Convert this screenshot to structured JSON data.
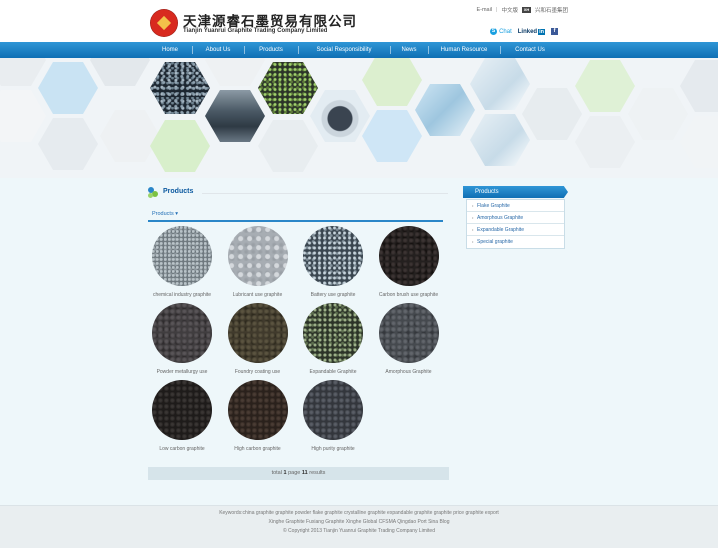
{
  "header": {
    "logo_cn": "天津源睿石墨贸易有限公司",
    "logo_en": "Tianjin Yuanrui Graphite Trading Company Limited",
    "top_links": [
      "E-mail",
      "中文版",
      "兴和石墨集团"
    ],
    "top_link_logo": "XH",
    "skype_label": "Chat",
    "linkedin_label": "Linked",
    "linkedin_badge": "in",
    "facebook_label": "f"
  },
  "nav": {
    "items": [
      "Home",
      "About Us",
      "Products",
      "Social Responsibility",
      "News",
      "Human Resource",
      "Contact Us"
    ]
  },
  "products": {
    "title": "Products",
    "tab_label": "Products ▾",
    "items": [
      {
        "caption": "chemical industry graphite",
        "texture": "gray"
      },
      {
        "caption": "Lubricant use graphite",
        "texture": "silver"
      },
      {
        "caption": "Battery use graphite",
        "texture": "flake"
      },
      {
        "caption": "Carbon brush use graphite",
        "texture": "black"
      },
      {
        "caption": "Powder metallurgy use",
        "texture": "charcoal"
      },
      {
        "caption": "Foundry coating use",
        "texture": "brown"
      },
      {
        "caption": "Expandable Graphite",
        "texture": "green"
      },
      {
        "caption": "Amorphous Graphite",
        "texture": "amorph"
      },
      {
        "caption": "Low carbon graphite",
        "texture": "deep"
      },
      {
        "caption": "High carbon graphite",
        "texture": "deepbrown"
      },
      {
        "caption": "High purity graphite",
        "texture": "slate"
      }
    ],
    "pager": {
      "prefix": "total",
      "pages": "1",
      "mid": "page",
      "results": "11",
      "suffix": "results"
    }
  },
  "sidebar": {
    "title": "Products",
    "items": [
      "Flake Graphite",
      "Amorphous Graphite",
      "Expandable Graphite",
      "Special graphite"
    ]
  },
  "footer": {
    "keywords": "Keywords:china graphite graphite powder flake graphite crystalline graphite expandable graphite graphite price graphite export",
    "links": "Xinghe Graphite Fuxiang Graphite Xinghe Global CFSMA Qingdao Port Sina Blog",
    "copyright": "© Copyright 2013 Tianjin Yuanrui Graphite Trading Company Limited"
  },
  "colors": {
    "nav_blue": "#1a7fc4",
    "title_blue": "#0d5aa0",
    "dot_green": "#7cc242",
    "dot_blue": "#2a86c8"
  }
}
